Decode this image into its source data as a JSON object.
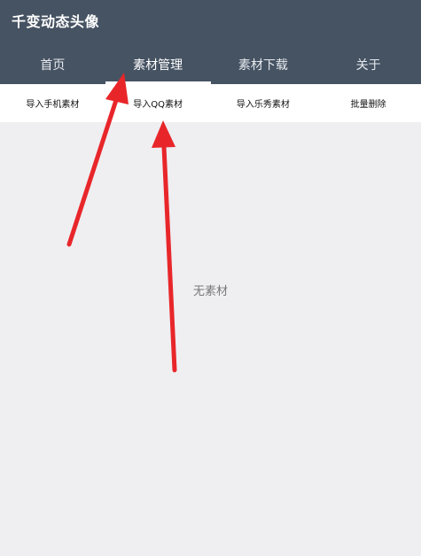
{
  "app": {
    "title": "千变动态头像"
  },
  "tabs": [
    {
      "label": "首页",
      "active": false
    },
    {
      "label": "素材管理",
      "active": true
    },
    {
      "label": "素材下载",
      "active": false
    },
    {
      "label": "关于",
      "active": false
    }
  ],
  "actions": [
    {
      "label": "导入手机素材"
    },
    {
      "label": "导入QQ素材"
    },
    {
      "label": "导入乐秀素材"
    },
    {
      "label": "批量删除"
    }
  ],
  "empty_state": {
    "text": "无素材"
  },
  "colors": {
    "header_bg": "#465363",
    "page_bg": "#efeef1",
    "annotation_arrow": "#e8262a"
  }
}
